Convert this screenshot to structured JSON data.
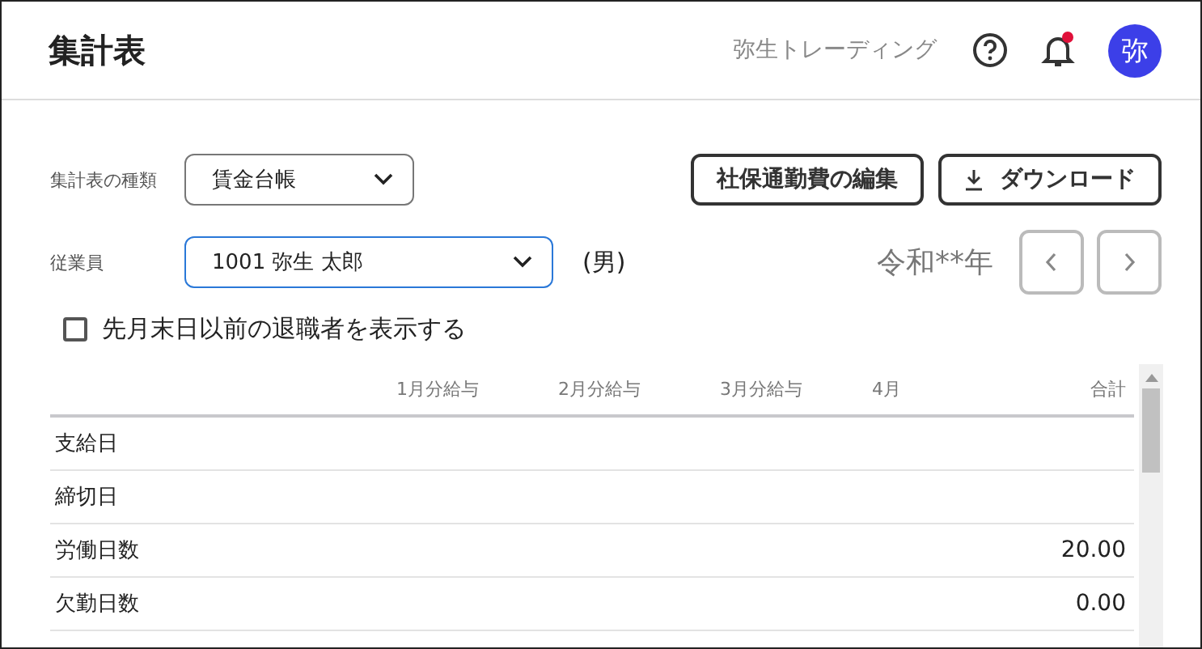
{
  "header": {
    "title": "集計表",
    "company": "弥生トレーディング",
    "notification_unread": true,
    "avatar": "弥"
  },
  "report_type": {
    "label": "集計表の種類",
    "value": "賃金台帳"
  },
  "buttons": [
    {
      "kind": "plain",
      "label": "社保通勤費の編集"
    },
    {
      "kind": "download",
      "label": "ダウンロード"
    }
  ],
  "employee": {
    "label": "従業員",
    "value": "1001 弥生 太郎",
    "gender": "(男)"
  },
  "year": {
    "label": "令和**年"
  },
  "show_retired": {
    "label": "先月末日以前の退職者を表示する",
    "checked": false
  },
  "table": {
    "columns": [
      "1月分給与",
      "2月分給与",
      "3月分給与",
      "4月",
      "合計"
    ],
    "rows": [
      {
        "label": "支給日",
        "total": ""
      },
      {
        "label": "締切日",
        "total": ""
      },
      {
        "label": "労働日数",
        "total": "20.00"
      },
      {
        "label": "欠勤日数",
        "total": "0.00"
      }
    ]
  }
}
